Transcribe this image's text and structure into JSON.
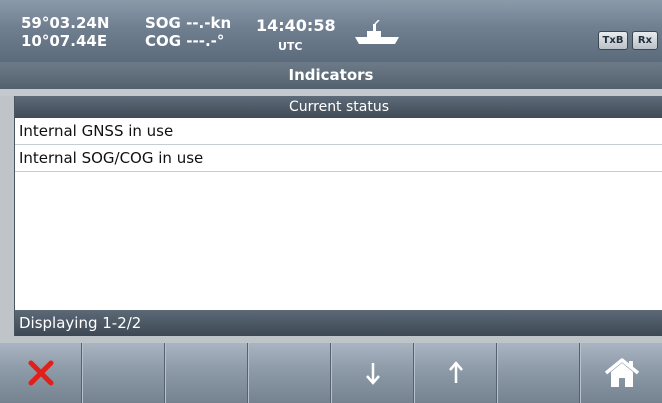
{
  "status": {
    "latitude": "59°03.24N",
    "longitude": "10°07.44E",
    "sog": "SOG --.-kn",
    "cog": "COG ---.-°",
    "time": "14:40:58",
    "timezone": "UTC",
    "txb_label": "TxB",
    "rx_label": "Rx"
  },
  "title": "Indicators",
  "panel": {
    "header": "Current status",
    "rows": [
      "Internal GNSS in use",
      "Internal SOG/COG in use"
    ],
    "footer": "Displaying 1-2/2"
  },
  "softkeys": [
    {
      "name": "cancel-button",
      "icon": "close-icon"
    },
    {
      "name": "softkey-2",
      "icon": ""
    },
    {
      "name": "softkey-3",
      "icon": ""
    },
    {
      "name": "softkey-4",
      "icon": ""
    },
    {
      "name": "scroll-down-button",
      "icon": "arrow-down-icon"
    },
    {
      "name": "scroll-up-button",
      "icon": "arrow-up-icon"
    },
    {
      "name": "softkey-7",
      "icon": ""
    },
    {
      "name": "home-button",
      "icon": "home-icon"
    }
  ],
  "colors": {
    "close_icon": "#e0201b",
    "header_bg": "#6f7f90",
    "panel_bg": "#ffffff"
  }
}
